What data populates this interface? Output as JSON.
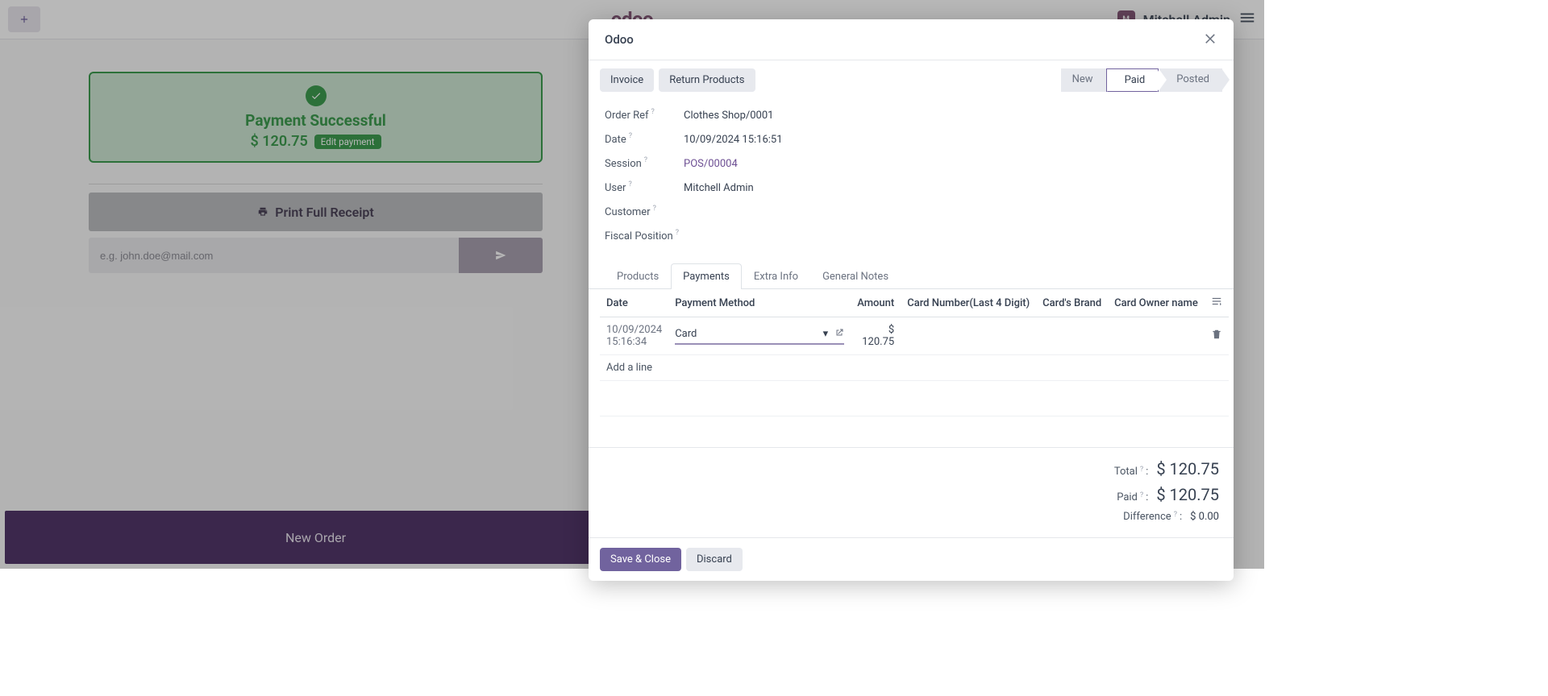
{
  "topbar": {
    "user_initials": "M",
    "username": "Mitchell Admin"
  },
  "pos": {
    "success_title": "Payment Successful",
    "success_amount": "$ 120.75",
    "edit_payment_label": "Edit payment",
    "print_label": "Print Full Receipt",
    "email_placeholder": "e.g. john.doe@mail.com",
    "new_order_label": "New Order"
  },
  "modal": {
    "title": "Odoo",
    "buttons": {
      "invoice": "Invoice",
      "return_products": "Return Products",
      "save_close": "Save & Close",
      "discard": "Discard"
    },
    "status": {
      "steps": [
        "New",
        "Paid",
        "Posted"
      ],
      "active_index": 1
    },
    "fields": {
      "order_ref": {
        "label": "Order Ref",
        "value": "Clothes Shop/0001"
      },
      "date": {
        "label": "Date",
        "value": "10/09/2024 15:16:51"
      },
      "session": {
        "label": "Session",
        "value": "POS/00004"
      },
      "user": {
        "label": "User",
        "value": "Mitchell Admin"
      },
      "customer": {
        "label": "Customer",
        "value": ""
      },
      "fiscal_position": {
        "label": "Fiscal Position",
        "value": ""
      }
    },
    "tabs": [
      "Products",
      "Payments",
      "Extra Info",
      "General Notes"
    ],
    "active_tab": 1,
    "columns": {
      "date": "Date",
      "payment_method": "Payment Method",
      "amount": "Amount",
      "card_number": "Card Number(Last 4 Digit)",
      "cards_brand": "Card's Brand",
      "card_owner": "Card Owner name"
    },
    "rows": [
      {
        "date": "10/09/2024 15:16:34",
        "payment_method": "Card",
        "amount": "$ 120.75",
        "card_number": "",
        "cards_brand": "",
        "card_owner": ""
      }
    ],
    "add_line": "Add a line",
    "totals": {
      "total": {
        "label": "Total",
        "value": "$ 120.75"
      },
      "paid": {
        "label": "Paid",
        "value": "$ 120.75"
      },
      "difference": {
        "label": "Difference",
        "value": "$ 0.00"
      }
    }
  }
}
